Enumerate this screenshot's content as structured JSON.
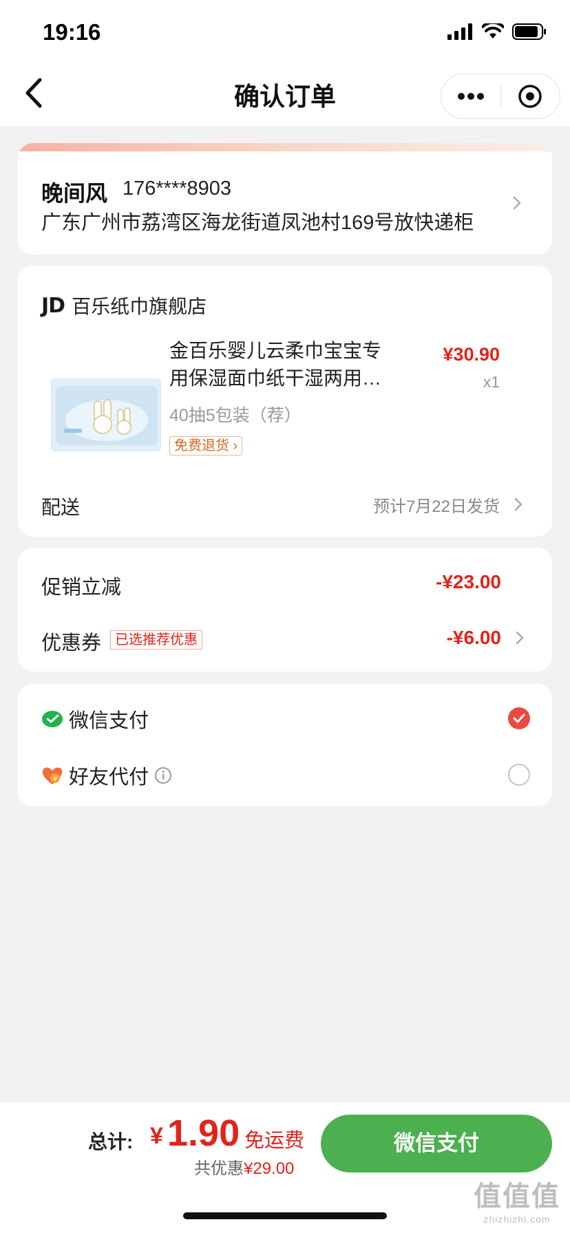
{
  "status_bar": {
    "time": "19:16"
  },
  "nav": {
    "title": "确认订单"
  },
  "address": {
    "name": "晚间风",
    "phone": "176****8903",
    "detail": "广东广州市荔湾区海龙街道凤池村169号放快递柜"
  },
  "store": {
    "logo": "JD",
    "name": "百乐纸巾旗舰店"
  },
  "product": {
    "title": "金百乐婴儿云柔巾宝宝专用保湿面巾纸干湿两用…",
    "spec": "40抽5包装（荐）",
    "return_badge": "免费退货 ›",
    "price": "¥30.90",
    "qty": "x1"
  },
  "delivery": {
    "label": "配送",
    "value": "预计7月22日发货"
  },
  "promotion": {
    "discount_label": "促销立减",
    "discount_value": "-¥23.00",
    "coupon_label": "优惠券",
    "coupon_tag": "已选推荐优惠",
    "coupon_value": "-¥6.00"
  },
  "payment": {
    "methods": [
      {
        "label": "微信支付",
        "selected": true
      },
      {
        "label": "好友代付",
        "selected": false
      }
    ]
  },
  "footer": {
    "total_label": "总计:",
    "currency": "¥",
    "amount": "1.90",
    "shipping": "免运费",
    "saved_label": "共优惠",
    "saved_amount": "¥29.00",
    "pay_button": "微信支付"
  },
  "watermark": {
    "big": "值值值",
    "small": "zhizhizhi.com"
  },
  "colors": {
    "accent_red": "#e2231a",
    "pay_green": "#4caf50"
  }
}
